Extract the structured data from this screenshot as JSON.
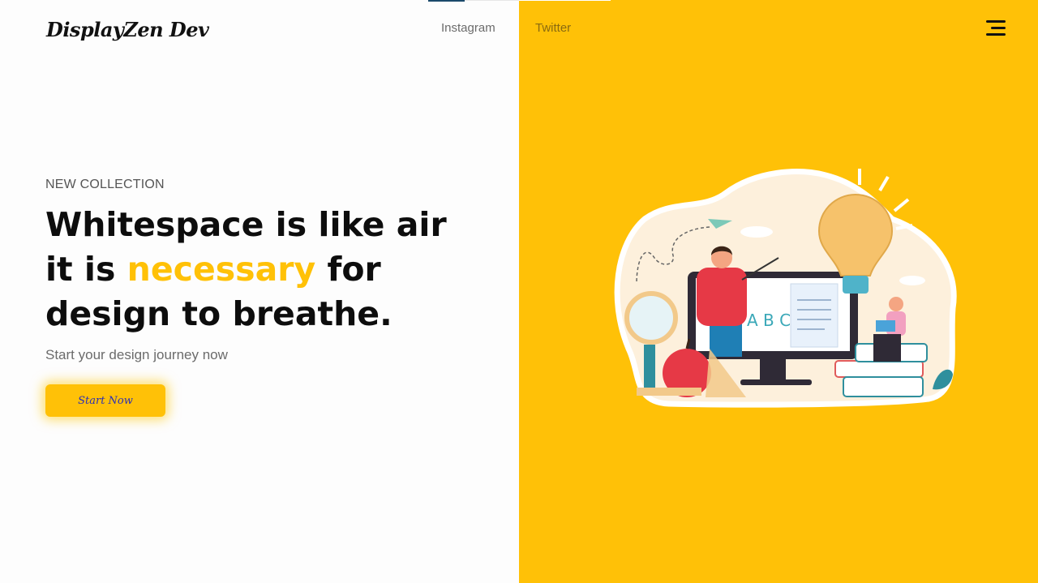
{
  "header": {
    "logo": "DisplayZen Dev",
    "nav": [
      {
        "label": "Instagram"
      },
      {
        "label": "Twitter"
      }
    ],
    "menu_icon": "hamburger-menu-icon"
  },
  "hero": {
    "eyebrow": "NEW COLLECTION",
    "headline_line1": "Whitespace is like air",
    "headline_line2_pre": "it is ",
    "headline_line2_accent": "necessary",
    "headline_line2_post": " for",
    "headline_line3": "design to breathe.",
    "subtitle": "Start your design journey now",
    "cta_label": "Start Now"
  },
  "illustration": {
    "board_text": "A B C",
    "icons": [
      "teacher-figure",
      "lightbulb-icon",
      "magnifier-icon",
      "apple-icon",
      "books-icon",
      "monitor-icon",
      "paper-plane-icon"
    ]
  },
  "colors": {
    "accent": "#ffc107",
    "text": "#0d0d0d",
    "muted": "#6b6b6b",
    "cta_text": "#2b2fb5"
  }
}
